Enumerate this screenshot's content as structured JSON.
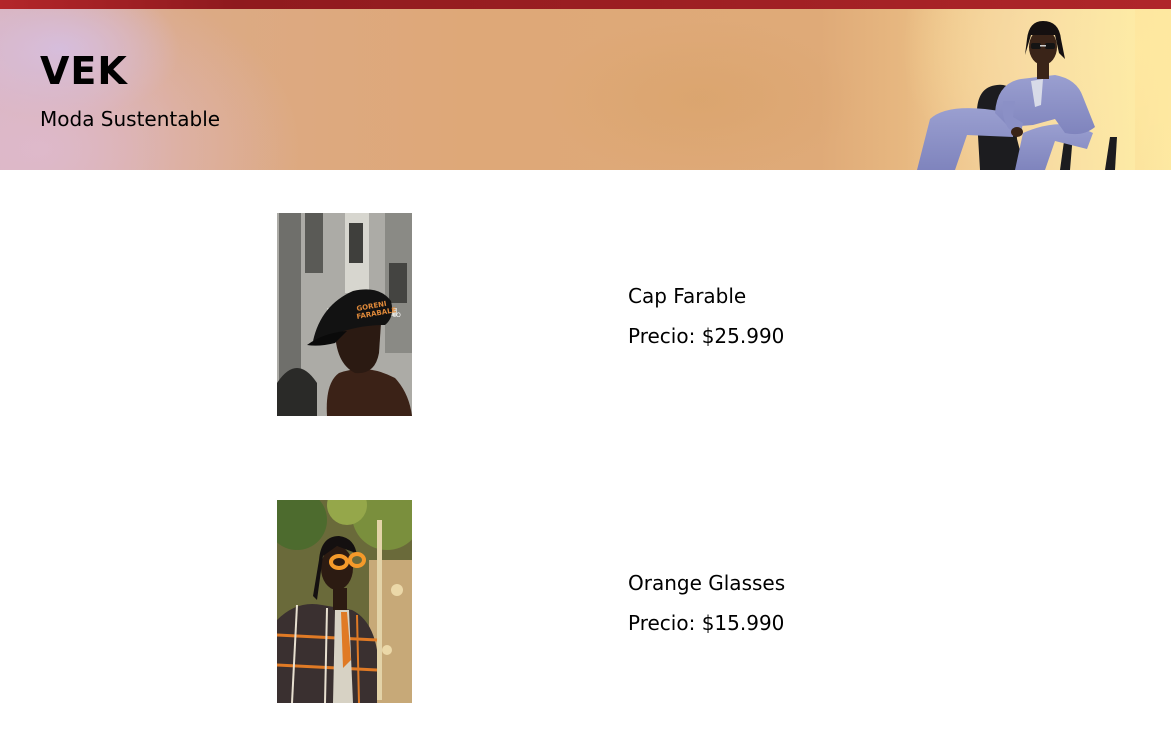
{
  "header": {
    "brand": "VEK",
    "tagline": "Moda Sustentable",
    "hero_image": "model-seated-in-lavender-suit-on-chair"
  },
  "products": [
    {
      "name": "Cap Farable",
      "price_label": "Precio:",
      "price": "$25.990",
      "image": "model-wearing-black-cap"
    },
    {
      "name": "Orange Glasses",
      "price_label": "Precio:",
      "price": "$15.990",
      "image": "model-wearing-orange-glasses-plaid-jacket"
    }
  ],
  "colors": {
    "top_bar": "#9e1f23",
    "hero_base": "#dfaa78",
    "text": "#000000",
    "background": "#ffffff"
  }
}
